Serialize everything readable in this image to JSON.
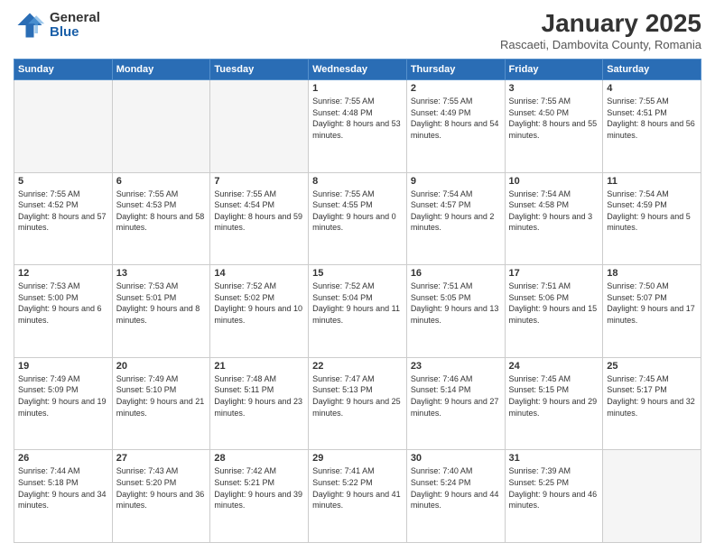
{
  "header": {
    "logo_general": "General",
    "logo_blue": "Blue",
    "month": "January 2025",
    "location": "Rascaeti, Dambovita County, Romania"
  },
  "weekdays": [
    "Sunday",
    "Monday",
    "Tuesday",
    "Wednesday",
    "Thursday",
    "Friday",
    "Saturday"
  ],
  "weeks": [
    [
      {
        "day": "",
        "empty": true
      },
      {
        "day": "",
        "empty": true
      },
      {
        "day": "",
        "empty": true
      },
      {
        "day": "1",
        "sunrise": "7:55 AM",
        "sunset": "4:48 PM",
        "daylight": "8 hours and 53 minutes."
      },
      {
        "day": "2",
        "sunrise": "7:55 AM",
        "sunset": "4:49 PM",
        "daylight": "8 hours and 54 minutes."
      },
      {
        "day": "3",
        "sunrise": "7:55 AM",
        "sunset": "4:50 PM",
        "daylight": "8 hours and 55 minutes."
      },
      {
        "day": "4",
        "sunrise": "7:55 AM",
        "sunset": "4:51 PM",
        "daylight": "8 hours and 56 minutes."
      }
    ],
    [
      {
        "day": "5",
        "sunrise": "7:55 AM",
        "sunset": "4:52 PM",
        "daylight": "8 hours and 57 minutes."
      },
      {
        "day": "6",
        "sunrise": "7:55 AM",
        "sunset": "4:53 PM",
        "daylight": "8 hours and 58 minutes."
      },
      {
        "day": "7",
        "sunrise": "7:55 AM",
        "sunset": "4:54 PM",
        "daylight": "8 hours and 59 minutes."
      },
      {
        "day": "8",
        "sunrise": "7:55 AM",
        "sunset": "4:55 PM",
        "daylight": "9 hours and 0 minutes."
      },
      {
        "day": "9",
        "sunrise": "7:54 AM",
        "sunset": "4:57 PM",
        "daylight": "9 hours and 2 minutes."
      },
      {
        "day": "10",
        "sunrise": "7:54 AM",
        "sunset": "4:58 PM",
        "daylight": "9 hours and 3 minutes."
      },
      {
        "day": "11",
        "sunrise": "7:54 AM",
        "sunset": "4:59 PM",
        "daylight": "9 hours and 5 minutes."
      }
    ],
    [
      {
        "day": "12",
        "sunrise": "7:53 AM",
        "sunset": "5:00 PM",
        "daylight": "9 hours and 6 minutes."
      },
      {
        "day": "13",
        "sunrise": "7:53 AM",
        "sunset": "5:01 PM",
        "daylight": "9 hours and 8 minutes."
      },
      {
        "day": "14",
        "sunrise": "7:52 AM",
        "sunset": "5:02 PM",
        "daylight": "9 hours and 10 minutes."
      },
      {
        "day": "15",
        "sunrise": "7:52 AM",
        "sunset": "5:04 PM",
        "daylight": "9 hours and 11 minutes."
      },
      {
        "day": "16",
        "sunrise": "7:51 AM",
        "sunset": "5:05 PM",
        "daylight": "9 hours and 13 minutes."
      },
      {
        "day": "17",
        "sunrise": "7:51 AM",
        "sunset": "5:06 PM",
        "daylight": "9 hours and 15 minutes."
      },
      {
        "day": "18",
        "sunrise": "7:50 AM",
        "sunset": "5:07 PM",
        "daylight": "9 hours and 17 minutes."
      }
    ],
    [
      {
        "day": "19",
        "sunrise": "7:49 AM",
        "sunset": "5:09 PM",
        "daylight": "9 hours and 19 minutes."
      },
      {
        "day": "20",
        "sunrise": "7:49 AM",
        "sunset": "5:10 PM",
        "daylight": "9 hours and 21 minutes."
      },
      {
        "day": "21",
        "sunrise": "7:48 AM",
        "sunset": "5:11 PM",
        "daylight": "9 hours and 23 minutes."
      },
      {
        "day": "22",
        "sunrise": "7:47 AM",
        "sunset": "5:13 PM",
        "daylight": "9 hours and 25 minutes."
      },
      {
        "day": "23",
        "sunrise": "7:46 AM",
        "sunset": "5:14 PM",
        "daylight": "9 hours and 27 minutes."
      },
      {
        "day": "24",
        "sunrise": "7:45 AM",
        "sunset": "5:15 PM",
        "daylight": "9 hours and 29 minutes."
      },
      {
        "day": "25",
        "sunrise": "7:45 AM",
        "sunset": "5:17 PM",
        "daylight": "9 hours and 32 minutes."
      }
    ],
    [
      {
        "day": "26",
        "sunrise": "7:44 AM",
        "sunset": "5:18 PM",
        "daylight": "9 hours and 34 minutes."
      },
      {
        "day": "27",
        "sunrise": "7:43 AM",
        "sunset": "5:20 PM",
        "daylight": "9 hours and 36 minutes."
      },
      {
        "day": "28",
        "sunrise": "7:42 AM",
        "sunset": "5:21 PM",
        "daylight": "9 hours and 39 minutes."
      },
      {
        "day": "29",
        "sunrise": "7:41 AM",
        "sunset": "5:22 PM",
        "daylight": "9 hours and 41 minutes."
      },
      {
        "day": "30",
        "sunrise": "7:40 AM",
        "sunset": "5:24 PM",
        "daylight": "9 hours and 44 minutes."
      },
      {
        "day": "31",
        "sunrise": "7:39 AM",
        "sunset": "5:25 PM",
        "daylight": "9 hours and 46 minutes."
      },
      {
        "day": "",
        "empty": true
      }
    ]
  ]
}
